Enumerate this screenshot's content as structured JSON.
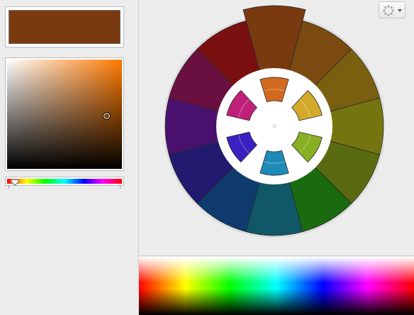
{
  "colors": {
    "selected": "#7a3a10",
    "picker_hue": "#ff7a00",
    "outer_wheel": [
      "#7a3a10",
      "#7a4a10",
      "#7a5f10",
      "#757510",
      "#5a6a10",
      "#1a6a10",
      "#105868",
      "#0f3a6e",
      "#221a6e",
      "#4a106e",
      "#6a1040",
      "#7a1010"
    ],
    "inner_wheel": {
      "top": "#d2691e",
      "top_right": "#d4aa2a",
      "bottom_right": "#88b022",
      "bottom": "#1e8ab8",
      "bottom_left": "#3a20c0",
      "top_left": "#c0207a"
    }
  },
  "picker": {
    "saturation": 0.83,
    "brightness": 0.48,
    "hue_position": 0.07
  },
  "icons": {
    "menu": "spinner-icon",
    "dropdown": "caret-down-icon"
  }
}
